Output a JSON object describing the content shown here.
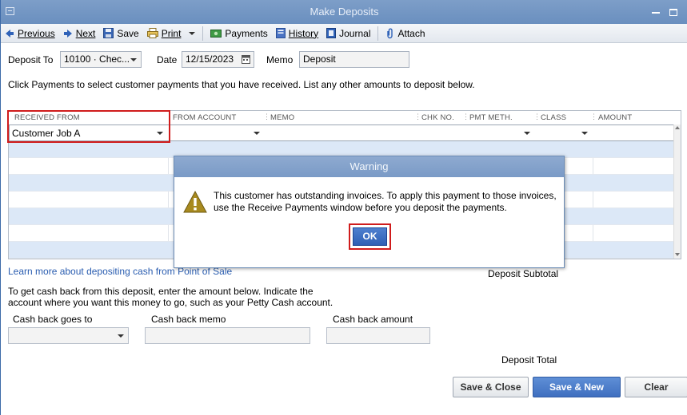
{
  "window": {
    "title": "Make Deposits"
  },
  "toolbar": {
    "previous": "Previous",
    "next": "Next",
    "save": "Save",
    "print": "Print",
    "payments": "Payments",
    "history": "History",
    "journal": "Journal",
    "attach": "Attach"
  },
  "header": {
    "deposit_to_label": "Deposit To",
    "deposit_to_value": "10100 · Chec...",
    "date_label": "Date",
    "date_value": "12/15/2023",
    "memo_label": "Memo",
    "memo_value": "Deposit"
  },
  "instructions": "Click Payments to select customer payments that you have received. List any other amounts to deposit below.",
  "grid": {
    "columns": [
      "RECEIVED FROM",
      "FROM ACCOUNT",
      "MEMO",
      "CHK NO.",
      "PMT METH.",
      "CLASS",
      "AMOUNT"
    ],
    "rows": [
      {
        "received_from": "Customer Job A"
      }
    ]
  },
  "learn_link": "Learn more about depositing cash from Point of Sale",
  "deposit_subtotal_label": "Deposit Subtotal",
  "cash_back": {
    "instructions": "To get cash back from this deposit, enter the amount below.  Indicate the account where you want this money to go, such as your Petty Cash account.",
    "goes_to_label": "Cash back goes to",
    "memo_label": "Cash back memo",
    "amount_label": "Cash back amount"
  },
  "deposit_total_label": "Deposit Total",
  "buttons": {
    "save_close": "Save & Close",
    "save_new": "Save & New",
    "clear": "Clear"
  },
  "warning_dialog": {
    "title": "Warning",
    "message": "This customer has outstanding invoices.  To apply this payment to those invoices, use the Receive Payments window before you deposit the payments.",
    "ok": "OK"
  },
  "colors": {
    "highlight_red": "#d01c1c",
    "row_alt": "#dce8f7",
    "primary_button": "#3f6fc0"
  }
}
